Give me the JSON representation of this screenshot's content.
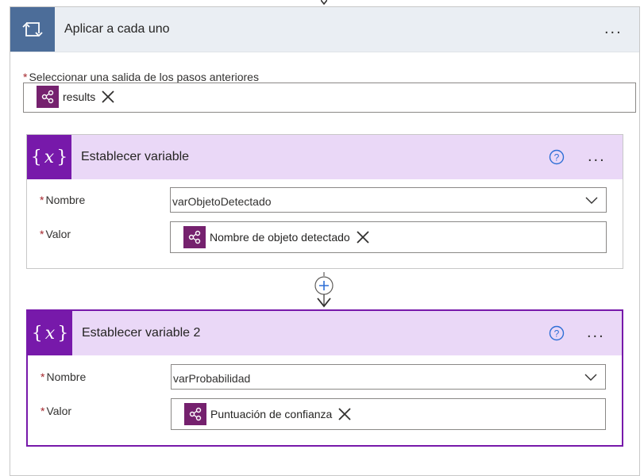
{
  "loop": {
    "title": "Aplicar a cada uno",
    "more_label": "...",
    "select_output_label": "Seleccionar una salida de los pasos anteriores",
    "select_output_required": "*",
    "select_output_token": "results"
  },
  "actions": [
    {
      "title": "Establecer variable",
      "more_label": "...",
      "fields": {
        "name_label": "Nombre",
        "name_value": "varObjetoDetectado",
        "value_label": "Valor",
        "value_token": "Nombre de objeto detectado",
        "required": "*"
      }
    },
    {
      "title": "Establecer variable 2",
      "more_label": "...",
      "fields": {
        "name_label": "Nombre",
        "name_value": "varProbabilidad",
        "value_label": "Valor",
        "value_token": "Puntuación de confianza",
        "required": "*"
      }
    }
  ],
  "icons": {
    "loop": "loop-arrows-icon",
    "variable": "curly-x-variable-icon",
    "token": "ai-builder-nodes-icon",
    "close": "close-x-icon",
    "help": "question-circle-icon",
    "chevron": "chevron-down-icon",
    "add": "plus-circle-icon",
    "connector": "arrow-down-icon"
  },
  "colors": {
    "loop_accent": "#4c6d99",
    "variable_accent": "#7719aa",
    "variable_header_bg": "#ead8f7",
    "token_bg": "#75216e",
    "required": "#a4262c"
  }
}
